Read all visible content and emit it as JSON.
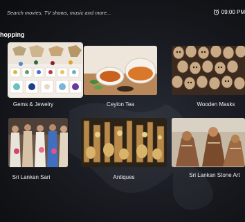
{
  "search": {
    "placeholder": "Search movies, TV shows, music and more..."
  },
  "clock": {
    "icon": "alarm-clock-icon",
    "time": "09:00 PM"
  },
  "section": {
    "title": "Shopping"
  },
  "cards": [
    {
      "label": "Gems & Jewelry"
    },
    {
      "label": "Ceylon Tea"
    },
    {
      "label": "Wooden Masks"
    },
    {
      "label": "Sri Lankan Sari"
    },
    {
      "label": "Antiques"
    },
    {
      "label": "Sri Lankan Stone Art"
    }
  ]
}
